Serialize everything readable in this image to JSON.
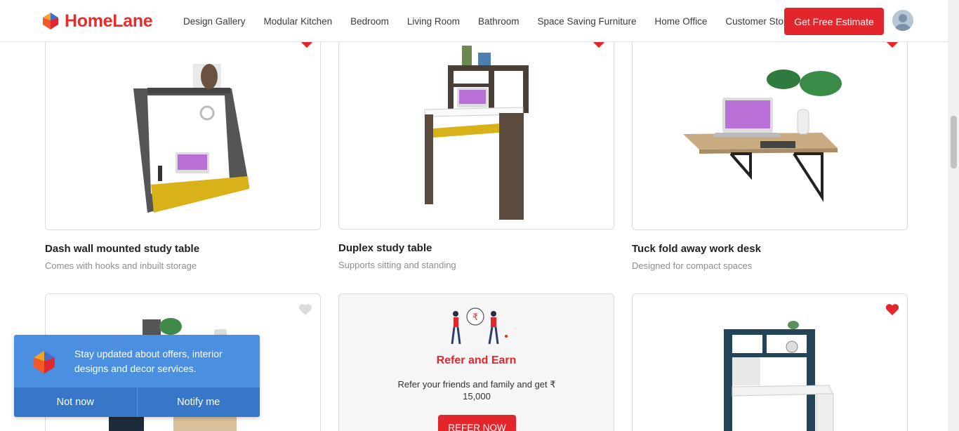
{
  "header": {
    "logo_text": "HomeLane",
    "nav": [
      "Design Gallery",
      "Modular Kitchen",
      "Bedroom",
      "Living Room",
      "Bathroom",
      "Space Saving Furniture",
      "Home Office",
      "Customer Stories"
    ],
    "cta_label": "Get Free Estimate"
  },
  "products": [
    {
      "title": "Dash wall mounted study table",
      "subtitle": "Comes with hooks and inbuilt storage",
      "favorited": true
    },
    {
      "title": "Duplex study table",
      "subtitle": "Supports sitting and standing",
      "favorited": true
    },
    {
      "title": "Tuck fold away work desk",
      "subtitle": "Designed for compact spaces",
      "favorited": true
    },
    {
      "title": "",
      "subtitle": "",
      "favorited": false
    },
    {
      "title": "",
      "subtitle": "",
      "favorited": true
    }
  ],
  "refer": {
    "title": "Refer and Earn",
    "text": "Refer your friends and family and get ₹ 15,000",
    "button": "REFER NOW"
  },
  "notification": {
    "text": "Stay updated about offers, interior designs and decor services.",
    "dismiss": "Not now",
    "accept": "Notify me"
  },
  "colors": {
    "brand": "#e3262c",
    "notify": "#4a8fe0"
  }
}
